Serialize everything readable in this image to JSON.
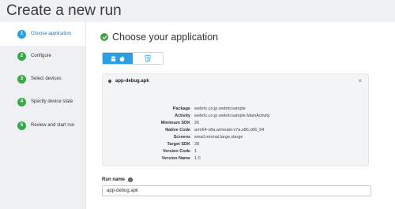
{
  "page": {
    "title": "Create a new run"
  },
  "steps": [
    {
      "number": "1",
      "label": "Choose application",
      "state": "active"
    },
    {
      "number": "2",
      "label": "Configure",
      "state": "pending"
    },
    {
      "number": "3",
      "label": "Select devices",
      "state": "pending"
    },
    {
      "number": "4",
      "label": "Specify device state",
      "state": "pending"
    },
    {
      "number": "5",
      "label": "Review and start run",
      "state": "pending"
    }
  ],
  "main": {
    "heading": "Choose your application",
    "platforms": [
      {
        "name": "android-apple",
        "icons": [
          "android-icon",
          "apple-icon"
        ],
        "selected": true
      },
      {
        "name": "web",
        "icons": [
          "html5-icon"
        ],
        "selected": false
      }
    ]
  },
  "app": {
    "file_name": "app-debug.apk",
    "close_symbol": "×",
    "details": [
      {
        "key": "Package",
        "value": "webrtc.co.jp.webrtcsample"
      },
      {
        "key": "Activity",
        "value": "webrtc.co.jp.webrtcsample.MainActivity"
      },
      {
        "key": "Minimum SDK",
        "value": "26"
      },
      {
        "key": "Native Code",
        "value": "arm64-v8a,armeabi-v7a,x86,x86_64"
      },
      {
        "key": "Screens",
        "value": "small,normal,large,xlarge"
      },
      {
        "key": "Target SDK",
        "value": "28"
      },
      {
        "key": "Version Code",
        "value": "1"
      },
      {
        "key": "Version Name",
        "value": "1.0"
      }
    ]
  },
  "run": {
    "label": "Run name",
    "info_symbol": "i",
    "value": "app-debug.apk"
  },
  "colors": {
    "accent": "#2d9ee0",
    "step_done": "#39a848",
    "check": "#43a047",
    "background": "#eef0f3"
  }
}
